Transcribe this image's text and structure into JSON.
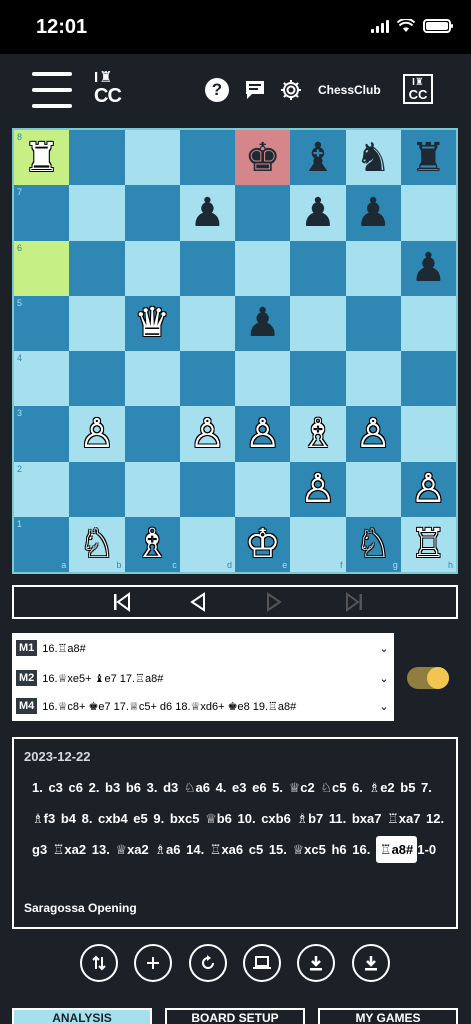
{
  "status_bar": {
    "time": "12:01"
  },
  "header": {
    "logo_top": "I♜",
    "logo_bottom": "CC",
    "help_icon": "?",
    "club_name": "ChessClub",
    "club_logo_top": "I♜",
    "club_logo_bottom": "CC"
  },
  "board": {
    "squares": [
      [
        "♜",
        "",
        "",
        "",
        "♚",
        "♝",
        "♞",
        "♜"
      ],
      [
        "",
        "",
        "",
        "♟",
        "",
        "♟",
        "♟",
        ""
      ],
      [
        "",
        "",
        "",
        "",
        "",
        "",
        "",
        "♟"
      ],
      [
        "",
        "",
        "♛",
        "",
        "♟",
        "",
        "",
        ""
      ],
      [
        "",
        "",
        "",
        "",
        "",
        "",
        "",
        ""
      ],
      [
        "",
        "♙",
        "",
        "♙",
        "♙",
        "♗",
        "♙",
        ""
      ],
      [
        "",
        "",
        "",
        "",
        "",
        "♙",
        "",
        "♙"
      ],
      [
        "",
        "♘",
        "♗",
        "",
        "♔",
        "",
        "♘",
        "♖"
      ]
    ],
    "colors": [
      [
        "w",
        "",
        "",
        "",
        "b",
        "b",
        "b",
        "b"
      ],
      [
        "",
        "",
        "",
        "b",
        "",
        "b",
        "b",
        ""
      ],
      [
        "",
        "",
        "",
        "",
        "",
        "",
        "",
        "b"
      ],
      [
        "",
        "",
        "w",
        "",
        "b",
        "",
        "",
        ""
      ],
      [
        "",
        "",
        "",
        "",
        "",
        "",
        "",
        ""
      ],
      [
        "",
        "w",
        "",
        "w",
        "w",
        "w",
        "w",
        ""
      ],
      [
        "",
        "",
        "",
        "",
        "",
        "w",
        "",
        "w"
      ],
      [
        "",
        "w",
        "w",
        "",
        "w",
        "",
        "w",
        "w"
      ]
    ],
    "rank_labels": [
      "8",
      "7",
      "6",
      "5",
      "4",
      "3",
      "2",
      "1"
    ],
    "file_labels": [
      "a",
      "b",
      "c",
      "d",
      "e",
      "f",
      "g",
      "h"
    ],
    "highlight_squares": [
      "a8",
      "a6"
    ],
    "check_square": "e8",
    "light_color": "#a6e0ef",
    "dark_color": "#2f88b4"
  },
  "mates": [
    {
      "tag": "M1",
      "line": "16.♖a8#"
    },
    {
      "tag": "M2",
      "line": "16.♕xe5+ ♝e7 17.♖a8#"
    },
    {
      "tag": "M4",
      "line": "16.♕c8+ ♚e7 17.♕c5+ d6 18.♕xd6+ ♚e8 19.♖a8#"
    }
  ],
  "record": {
    "date": "2023-12-22",
    "moves_before": "1. c3 c6  2. b3 b6  3. d3 ♘a6  4. e3 e6  5. ♕c2 ♘c5  6. ♗e2 b5  7. ♗f3 b4  8. cxb4 e5  9. bxc5 ♕b6  10. cxb6 ♗b7  11. bxa7 ♖xa7  12. g3 ♖xa2  13. ♕xa2 ♗a6  14. ♖xa6 c5  15. ♕xc5 h6  16. ",
    "current_move": "♖a8#",
    "result": "1-0",
    "opening": "Saragossa Opening"
  },
  "tabs": {
    "analysis": "ANALYSIS",
    "board_setup": "BOARD SETUP",
    "my_games": "MY GAMES"
  },
  "icons": {
    "flip": "flip-board-icon",
    "add": "plus-icon",
    "reset": "refresh-icon",
    "engine": "laptop-icon",
    "download1": "download-icon",
    "download2": "download-icon"
  }
}
